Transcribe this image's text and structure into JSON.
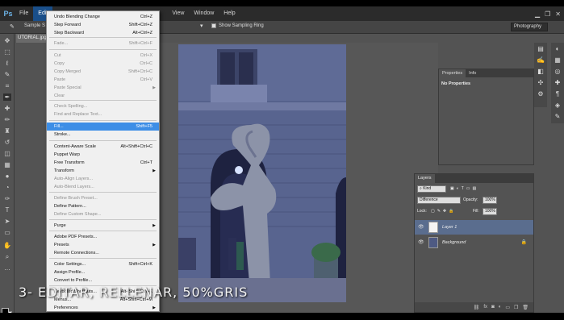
{
  "app": {
    "logo": "Ps"
  },
  "menubar": {
    "items": [
      "File",
      "Edit",
      "View",
      "Window",
      "Help"
    ],
    "active": "Edit"
  },
  "options_bar": {
    "sample_label": "Sample S",
    "show_sampling_ring": "Show Sampling Ring",
    "workspace": "Photography"
  },
  "document_tab": {
    "label": "UTORIAL.jpg"
  },
  "edit_menu": {
    "items": [
      {
        "label": "Undo Blending Change",
        "shortcut": "Ctrl+Z",
        "disabled": false
      },
      {
        "label": "Step Forward",
        "shortcut": "Shift+Ctrl+Z",
        "disabled": false
      },
      {
        "label": "Step Backward",
        "shortcut": "Alt+Ctrl+Z",
        "disabled": false
      },
      {
        "label": "Fade...",
        "shortcut": "Shift+Ctrl+F",
        "disabled": true
      },
      {
        "label": "Cut",
        "shortcut": "Ctrl+X",
        "disabled": true
      },
      {
        "label": "Copy",
        "shortcut": "Ctrl+C",
        "disabled": true
      },
      {
        "label": "Copy Merged",
        "shortcut": "Shift+Ctrl+C",
        "disabled": true
      },
      {
        "label": "Paste",
        "shortcut": "Ctrl+V",
        "disabled": true
      },
      {
        "label": "Paste Special",
        "shortcut": "",
        "disabled": true,
        "submenu": true
      },
      {
        "label": "Clear",
        "shortcut": "",
        "disabled": true
      },
      {
        "label": "Check Spelling...",
        "shortcut": "",
        "disabled": true
      },
      {
        "label": "Find and Replace Text...",
        "shortcut": "",
        "disabled": true
      },
      {
        "label": "Fill...",
        "shortcut": "Shift+F5",
        "disabled": false,
        "highlighted": true
      },
      {
        "label": "Stroke...",
        "shortcut": "",
        "disabled": false
      },
      {
        "label": "Content-Aware Scale",
        "shortcut": "Alt+Shift+Ctrl+C",
        "disabled": false
      },
      {
        "label": "Puppet Warp",
        "shortcut": "",
        "disabled": false
      },
      {
        "label": "Free Transform",
        "shortcut": "Ctrl+T",
        "disabled": false
      },
      {
        "label": "Transform",
        "shortcut": "",
        "disabled": false,
        "submenu": true
      },
      {
        "label": "Auto-Align Layers...",
        "shortcut": "",
        "disabled": true
      },
      {
        "label": "Auto-Blend Layers...",
        "shortcut": "",
        "disabled": true
      },
      {
        "label": "Define Brush Preset...",
        "shortcut": "",
        "disabled": true
      },
      {
        "label": "Define Pattern...",
        "shortcut": "",
        "disabled": false
      },
      {
        "label": "Define Custom Shape...",
        "shortcut": "",
        "disabled": true
      },
      {
        "label": "Purge",
        "shortcut": "",
        "disabled": false,
        "submenu": true
      },
      {
        "label": "Adobe PDF Presets...",
        "shortcut": "",
        "disabled": false
      },
      {
        "label": "Presets",
        "shortcut": "",
        "disabled": false,
        "submenu": true
      },
      {
        "label": "Remote Connections...",
        "shortcut": "",
        "disabled": false
      },
      {
        "label": "Color Settings...",
        "shortcut": "Shift+Ctrl+K",
        "disabled": false
      },
      {
        "label": "Assign Profile...",
        "shortcut": "",
        "disabled": false
      },
      {
        "label": "Convert to Profile...",
        "shortcut": "",
        "disabled": false
      },
      {
        "label": "Keyboard Shortcuts...",
        "shortcut": "Alt+Shift+Ctrl+K",
        "disabled": false
      },
      {
        "label": "Menus...",
        "shortcut": "Alt+Shift+Ctrl+M",
        "disabled": false
      },
      {
        "label": "Preferences",
        "shortcut": "",
        "disabled": false,
        "submenu": true
      }
    ]
  },
  "properties_panel": {
    "tabs": [
      "Properties",
      "Info"
    ],
    "message": "No Properties"
  },
  "layers_panel": {
    "tab": "Layers",
    "filter": "Kind",
    "blend_mode": "Difference",
    "opacity_label": "Opacity:",
    "opacity_value": "100%",
    "lock_label": "Lock:",
    "fill_label": "Fill:",
    "fill_value": "100%",
    "layers": [
      {
        "name": "Layer 1",
        "selected": true,
        "thumb_color": "#f4f4f4"
      },
      {
        "name": "Background",
        "selected": false,
        "thumb_color": "#4e5a83",
        "locked": true
      }
    ]
  },
  "caption": {
    "text": "3- EDITAR, RELLENAR, 50%GRIS"
  },
  "colors": {
    "menu_highlight": "#3d8ee6",
    "photo_tint": "#4e5a83"
  }
}
